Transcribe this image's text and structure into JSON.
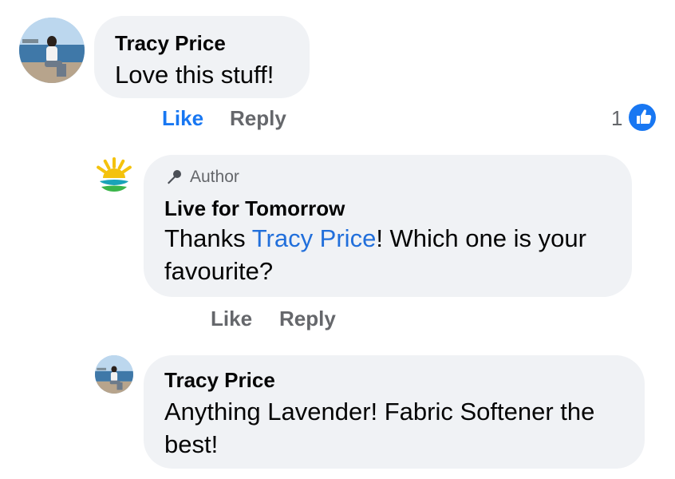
{
  "comments": [
    {
      "author": "Tracy Price",
      "text": "Love this stuff!",
      "actions": {
        "like": "Like",
        "reply": "Reply"
      },
      "reaction_count": "1",
      "liked": true
    },
    {
      "badge": "Author",
      "author": "Live for Tomorrow",
      "text_before": "Thanks ",
      "mention": "Tracy Price",
      "text_after": "! Which one is your favourite?",
      "actions": {
        "like": "Like",
        "reply": "Reply"
      }
    },
    {
      "author": "Tracy Price",
      "text": "Anything Lavender! Fabric Softener the best!"
    }
  ],
  "colors": {
    "bubble": "#f0f2f5",
    "link_blue": "#1877f2",
    "mention_blue": "#216fdb",
    "secondary_text": "#65676b"
  },
  "icons": {
    "author_badge": "microphone-icon",
    "reaction": "thumbs-up-icon"
  }
}
